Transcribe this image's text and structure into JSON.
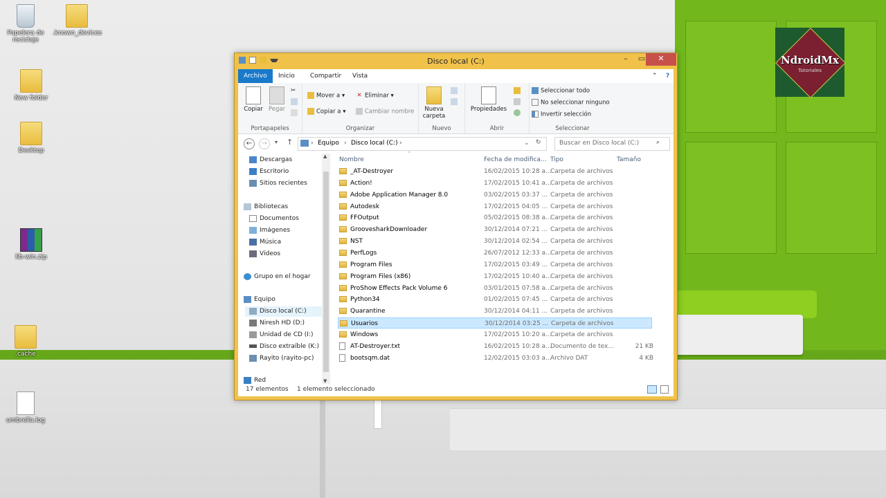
{
  "desktop": {
    "icons": [
      {
        "label": "Papelera de reciclaje",
        "icon": "recycle-bin-icon"
      },
      {
        "label": ".known_devices",
        "icon": "folder-icon"
      },
      {
        "label": "New folder",
        "icon": "folder-icon"
      },
      {
        "label": "Desktop",
        "icon": "folder-icon"
      },
      {
        "label": "lib-win.zip",
        "icon": "rar-archive-icon"
      },
      {
        "label": ".cache",
        "icon": "folder-icon"
      },
      {
        "label": "umbrella.log",
        "icon": "text-file-icon"
      }
    ],
    "logo": {
      "text": "NdroidMx",
      "subtext": "Tutoriales"
    }
  },
  "window": {
    "title": "Disco local (C:)",
    "controls": {
      "minimize": "–",
      "maximize": "▭",
      "close": "✕"
    }
  },
  "ribbon": {
    "tabs": [
      "Archivo",
      "Inicio",
      "Compartir",
      "Vista"
    ],
    "groups": {
      "portapapeles": {
        "label": "Portapapeles",
        "copy": "Copiar",
        "paste": "Pegar"
      },
      "organizar": {
        "label": "Organizar",
        "move": "Mover a ▾",
        "delete": "Eliminar ▾",
        "copyto": "Copiar a ▾",
        "rename": "Cambiar nombre"
      },
      "nuevo": {
        "label": "Nuevo",
        "newfolder": "Nueva carpeta"
      },
      "abrir": {
        "label": "Abrir",
        "properties": "Propiedades"
      },
      "seleccionar": {
        "label": "Seleccionar",
        "selectall": "Seleccionar todo",
        "selectnone": "No seleccionar ninguno",
        "invert": "Invertir selección"
      }
    }
  },
  "address": {
    "path": [
      "Equipo",
      "Disco local (C:)"
    ],
    "search_placeholder": "Buscar en Disco local (C:)"
  },
  "navpane": {
    "favorites": [
      "Descargas",
      "Escritorio",
      "Sitios recientes"
    ],
    "libraries_title": "Bibliotecas",
    "libraries": [
      "Documentos",
      "Imágenes",
      "Música",
      "Vídeos"
    ],
    "homegroup": "Grupo en el hogar",
    "computer_title": "Equipo",
    "drives": [
      "Disco local (C:)",
      "Niresh HD (D:)",
      "Unidad de CD (I:)",
      "Disco extraíble (K:)",
      "Rayito (rayito-pc)"
    ],
    "network": "Red",
    "selected": "Disco local (C:)"
  },
  "filelist": {
    "columns": {
      "name": "Nombre",
      "date": "Fecha de modifica...",
      "type": "Tipo",
      "size": "Tamaño"
    },
    "rows": [
      {
        "name": "_AT-Destroyer",
        "date": "16/02/2015 10:28 a...",
        "type": "Carpeta de archivos",
        "size": "",
        "kind": "folder"
      },
      {
        "name": "Action!",
        "date": "17/02/2015 10:41 a...",
        "type": "Carpeta de archivos",
        "size": "",
        "kind": "folder"
      },
      {
        "name": "Adobe Application Manager 8.0",
        "date": "03/02/2015 03:37 ...",
        "type": "Carpeta de archivos",
        "size": "",
        "kind": "folder"
      },
      {
        "name": "Autodesk",
        "date": "17/02/2015 04:05 ...",
        "type": "Carpeta de archivos",
        "size": "",
        "kind": "folder"
      },
      {
        "name": "FFOutput",
        "date": "05/02/2015 08:38 a...",
        "type": "Carpeta de archivos",
        "size": "",
        "kind": "folder"
      },
      {
        "name": "GroovesharkDownloader",
        "date": "30/12/2014 07:21 ...",
        "type": "Carpeta de archivos",
        "size": "",
        "kind": "folder"
      },
      {
        "name": "NST",
        "date": "30/12/2014 02:54 ...",
        "type": "Carpeta de archivos",
        "size": "",
        "kind": "folder"
      },
      {
        "name": "PerfLogs",
        "date": "26/07/2012 12:33 a...",
        "type": "Carpeta de archivos",
        "size": "",
        "kind": "folder"
      },
      {
        "name": "Program Files",
        "date": "17/02/2015 03:49 ...",
        "type": "Carpeta de archivos",
        "size": "",
        "kind": "folder"
      },
      {
        "name": "Program Files (x86)",
        "date": "17/02/2015 10:40 a...",
        "type": "Carpeta de archivos",
        "size": "",
        "kind": "folder"
      },
      {
        "name": "ProShow Effects Pack Volume 6",
        "date": "03/01/2015 07:58 a...",
        "type": "Carpeta de archivos",
        "size": "",
        "kind": "folder"
      },
      {
        "name": "Python34",
        "date": "01/02/2015 07:45 ...",
        "type": "Carpeta de archivos",
        "size": "",
        "kind": "folder"
      },
      {
        "name": "Quarantine",
        "date": "30/12/2014 04:11 ...",
        "type": "Carpeta de archivos",
        "size": "",
        "kind": "folder"
      },
      {
        "name": "Usuarios",
        "date": "30/12/2014 03:25 ...",
        "type": "Carpeta de archivos",
        "size": "",
        "kind": "folder",
        "selected": true
      },
      {
        "name": "Windows",
        "date": "17/02/2015 10:20 a...",
        "type": "Carpeta de archivos",
        "size": "",
        "kind": "folder"
      },
      {
        "name": "AT-Destroyer.txt",
        "date": "16/02/2015 10:28 a...",
        "type": "Documento de tex...",
        "size": "21 KB",
        "kind": "file"
      },
      {
        "name": "bootsqm.dat",
        "date": "12/02/2015 03:03 a...",
        "type": "Archivo DAT",
        "size": "4 KB",
        "kind": "file"
      }
    ]
  },
  "status": {
    "count": "17 elementos",
    "selection": "1 elemento seleccionado"
  },
  "colors": {
    "accent": "#1979ca",
    "selection": "#cce8ff",
    "window_frame": "#f0c24a",
    "wall_green": "#72b81d"
  }
}
